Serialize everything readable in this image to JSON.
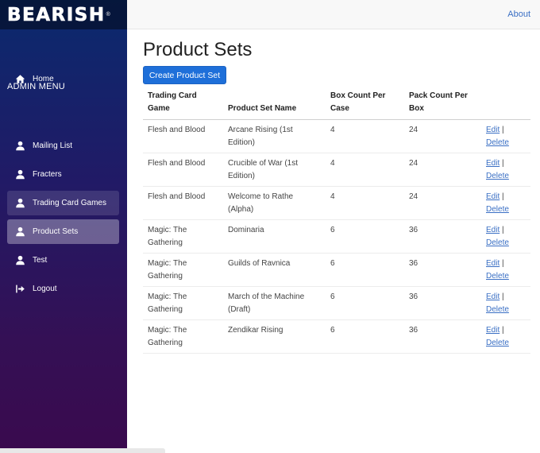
{
  "brand": {
    "name": "BEARISH",
    "registered": "®"
  },
  "sidebar": {
    "home": {
      "label": "Home",
      "icon": "home-icon"
    },
    "admin_heading": "ADMIN MENU",
    "items": [
      {
        "label": "Mailing List",
        "icon": "user-icon"
      },
      {
        "label": "Fracters",
        "icon": "user-icon"
      },
      {
        "label": "Trading Card Games",
        "icon": "user-icon"
      },
      {
        "label": "Product Sets",
        "icon": "user-icon"
      },
      {
        "label": "Test",
        "icon": "user-icon"
      },
      {
        "label": "Logout",
        "icon": "logout-icon"
      }
    ]
  },
  "topbar": {
    "about_label": "About"
  },
  "page": {
    "title": "Product Sets",
    "create_label": "Create Product Set"
  },
  "table": {
    "headers": {
      "game": "Trading Card Game",
      "name": "Product Set Name",
      "box": "Box Count Per Case",
      "pack": "Pack Count Per Box"
    },
    "edit_label": "Edit",
    "separator": "|",
    "delete_label": "Delete",
    "rows": [
      {
        "game": "Flesh and Blood",
        "name": "Arcane Rising (1st Edition)",
        "box": "4",
        "pack": "24"
      },
      {
        "game": "Flesh and Blood",
        "name": "Crucible of War (1st Edition)",
        "box": "4",
        "pack": "24"
      },
      {
        "game": "Flesh and Blood",
        "name": "Welcome to Rathe (Alpha)",
        "box": "4",
        "pack": "24"
      },
      {
        "game": "Magic: The Gathering",
        "name": "Dominaria",
        "box": "6",
        "pack": "36"
      },
      {
        "game": "Magic: The Gathering",
        "name": "Guilds of Ravnica",
        "box": "6",
        "pack": "36"
      },
      {
        "game": "Magic: The Gathering",
        "name": "March of the Machine (Draft)",
        "box": "6",
        "pack": "36"
      },
      {
        "game": "Magic: The Gathering",
        "name": "Zendikar Rising",
        "box": "6",
        "pack": "36"
      }
    ]
  },
  "colors": {
    "accent": "#1e6fd9",
    "link": "#3a6fc4"
  }
}
